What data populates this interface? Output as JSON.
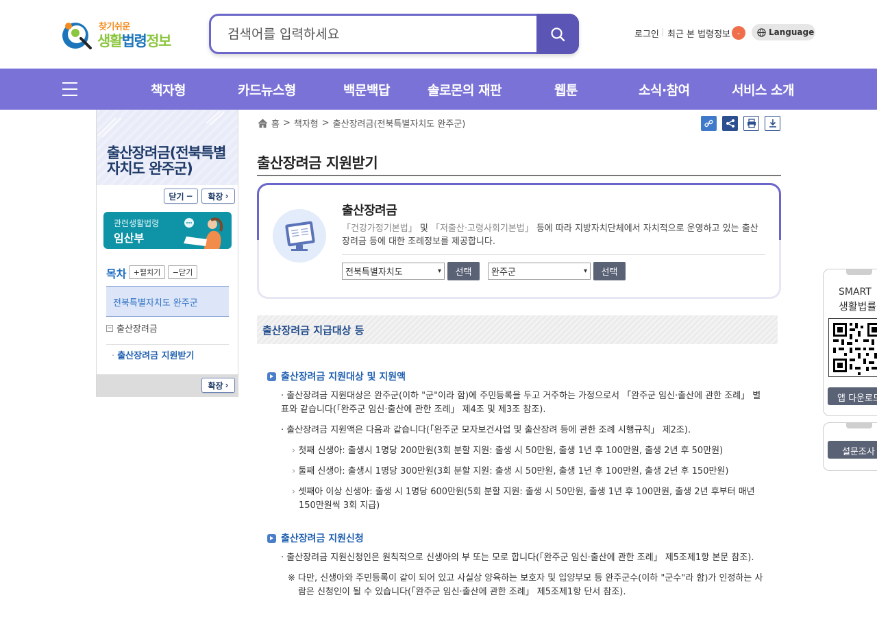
{
  "header": {
    "logo_small": "찾기쉬운",
    "logo_big_1": "생활",
    "logo_big_2": "법령",
    "logo_big_3": "정보",
    "search_placeholder": "검색어를 입력하세요",
    "login": "로그인",
    "recent": "최근 본 법령정보",
    "recent_count": "-",
    "language": "Language"
  },
  "nav": {
    "items": [
      "책자형",
      "카드뉴스형",
      "백문백답",
      "솔로몬의 재판",
      "웹툰",
      "소식·참여",
      "서비스 소개"
    ]
  },
  "sidebar": {
    "title": "출산장려금(전북특별자치도 완주군)",
    "close_label": "닫기",
    "expand_label": "확장",
    "related_caption": "관련생활법령",
    "related_title": "임산부",
    "toc_label": "목차",
    "toc_expand": "펼치기",
    "toc_close": "닫기",
    "toc_selected": "전북특별자치도 완주군",
    "toc_item": "출산장려금",
    "toc_sub": "출산장려금 지원받기",
    "footer_expand": "확장"
  },
  "breadcrumb": [
    "홈",
    "책자형",
    "출산장려금(전북특별자치도 완주군)"
  ],
  "page_title": "출산장려금 지원받기",
  "card": {
    "title": "출산장려금",
    "desc_q1": "「건강가정기본법」",
    "desc_and": " 및 ",
    "desc_q2": "「저출산·고령사회기본법」",
    "desc_rest": " 등에 따라 지방자치단체에서 자치적으로 운영하고 있는 출산장려금 등에 대한 조례정보를 제공합니다.",
    "select1": "전북특별자치도",
    "select2": "완주군",
    "select_btn": "선택"
  },
  "content": {
    "section_title": "출산장려금 지급대상 등",
    "h1": "출산장려금 지원대상 및 지원액",
    "p1": "· 출산장려금 지원대상은 완주군(이하 \"군\"이라 함)에 주민등록을 두고 거주하는 가정으로서 「완주군 임신·출산에 관한 조례」 별표와 같습니다(「완주군 임신·출산에 관한 조례」 제4조 및 제3조 참조).",
    "p2": "· 출산장려금 지원액은 다음과 같습니다(「완주군 모자보건사업 및 출산장려 등에 관한 조례 시행규칙」 제2조).",
    "b1": "첫째 신생아: 출생시 1명당 200만원(3회 분할 지원: 출생 시 50만원, 출생 1년 후 100만원, 출생 2년 후 50만원)",
    "b2": "둘째 신생아: 출생시 1명당 300만원(3회 분할 지원: 출생 시 50만원, 출생 1년 후 100만원, 출생 2년 후 150만원)",
    "b3": "셋째아 이상 신생아: 출생 시 1명당 600만원(5회 분할 지원: 출생 시 50만원, 출생 1년 후 100만원, 출생 2년 후부터 매년 150만원씩 3회 지급)",
    "h2": "출산장려금 지원신청",
    "p3": "· 출산장려금 지원신청인은 원칙적으로 신생아의 부 또는 모로 합니다(「완주군 임신·출산에 관한 조례」 제5조제1항 본문 참조).",
    "p4": "※ 다만, 신생아와 주민등록이 같이 되어 있고 사실상 양육하는 보호자 및 입양부모 등 완주군수(이하 \"군수\"라 함)가 인정하는 사람은 신청인이 될 수 있습니다(「완주군 임신·출산에 관한 조례」 제5조제1항 단서 참조)."
  },
  "floating": {
    "smart_1": "SMART",
    "smart_2": "생활법률",
    "app_download": "앱 다운로드",
    "survey": "설문조사"
  }
}
